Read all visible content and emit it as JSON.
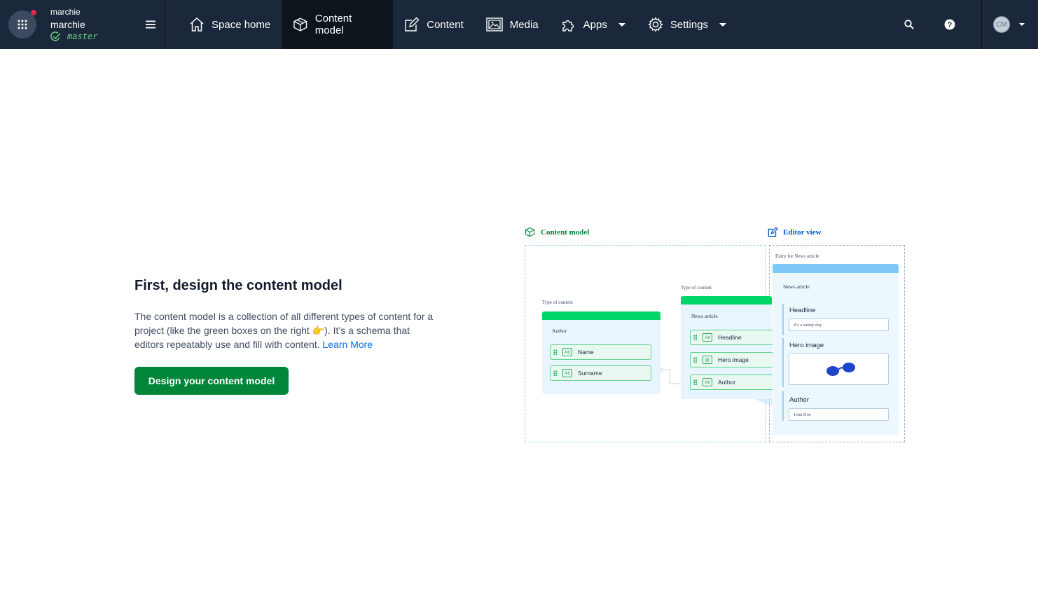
{
  "space": {
    "org": "marchie",
    "name": "marchie",
    "environment": "master",
    "notification_color": "#da294a"
  },
  "nav": {
    "items": [
      {
        "label": "Space home",
        "icon": "home-icon"
      },
      {
        "label": "Content model",
        "icon": "cube-icon",
        "active": true
      },
      {
        "label": "Content",
        "icon": "edit-icon"
      },
      {
        "label": "Media",
        "icon": "image-icon"
      },
      {
        "label": "Apps",
        "icon": "puzzle-icon",
        "dropdown": true
      },
      {
        "label": "Settings",
        "icon": "gear-icon",
        "dropdown": true
      }
    ],
    "right_icons": [
      "search-icon",
      "help-icon"
    ]
  },
  "account": {
    "initials": "CM"
  },
  "intro": {
    "title": "First, design the content model",
    "body": "The content model is a collection of all different types of content for a project (like the green boxes on the right 👉). It’s a schema that editors repeatably use and fill with content.",
    "link": "Learn More",
    "cta": "Design your content model"
  },
  "illustration": {
    "model_heading": "Content model",
    "editor_heading": "Editor view",
    "type_caption_1": "Type of content",
    "type_caption_2": "Type of content",
    "author_card": {
      "title": "Author",
      "fields": [
        "Name",
        "Surname"
      ]
    },
    "news_card": {
      "title": "News article",
      "fields": [
        "Headline",
        "Hero image",
        "Author"
      ]
    },
    "editor": {
      "caption": "Entry for News article",
      "title": "News article",
      "headline_label": "Headline",
      "headline_value": "It's a sunny day",
      "hero_label": "Hero image",
      "author_label": "Author",
      "author_value": "John Doe"
    },
    "colors": {
      "model_green": "#00d567",
      "editor_blue": "#7ec9f7",
      "heading_green": "#008539",
      "heading_blue": "#0059c8"
    }
  }
}
